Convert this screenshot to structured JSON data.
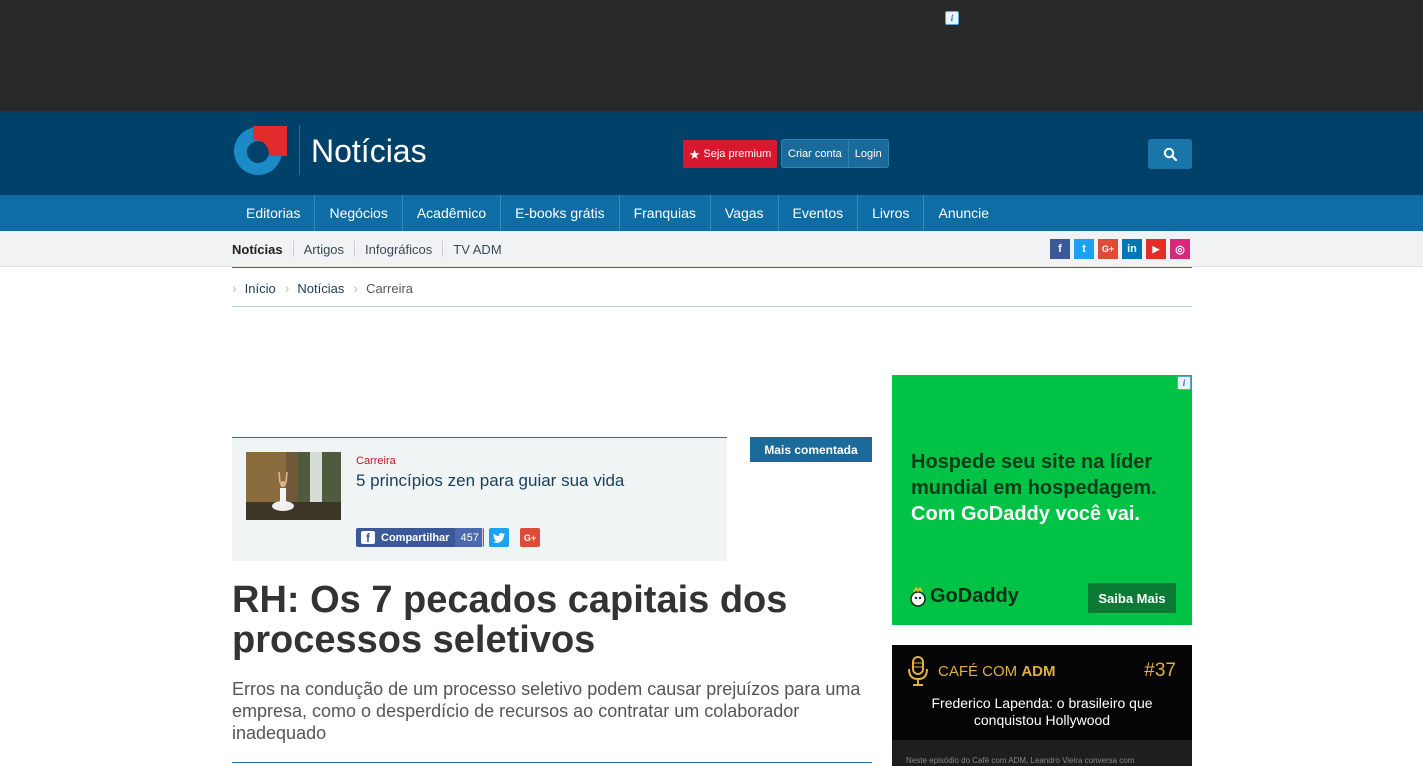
{
  "top_ad": {
    "adchoices_icon": "info-icon"
  },
  "header": {
    "title": "Notícias",
    "premium_label": "Seja premium",
    "create_account_label": "Criar conta",
    "login_label": "Login"
  },
  "main_nav": [
    "Editorias",
    "Negócios",
    "Acadêmico",
    "E-books grátis",
    "Franquias",
    "Vagas",
    "Eventos",
    "Livros",
    "Anuncie"
  ],
  "sub_nav": [
    "Notícias",
    "Artigos",
    "Infográficos",
    "TV ADM"
  ],
  "social": [
    {
      "name": "facebook",
      "glyph": "f",
      "color": "#3b5998"
    },
    {
      "name": "twitter",
      "glyph": "t",
      "color": "#1da1f2"
    },
    {
      "name": "google-plus",
      "glyph": "G+",
      "color": "#dd4b39"
    },
    {
      "name": "linkedin",
      "glyph": "in",
      "color": "#0077b5"
    },
    {
      "name": "youtube",
      "glyph": "▶",
      "color": "#e52d27"
    },
    {
      "name": "instagram",
      "glyph": "◎",
      "color": "#d6297a"
    }
  ],
  "breadcrumb": [
    "Início",
    "Notícias",
    "Carreira"
  ],
  "related": {
    "kicker": "Carreira",
    "title": "5 princípios zen para guiar sua vida",
    "share_label": "Compartilhar",
    "share_count": "457",
    "gplus_label": "G+"
  },
  "badge": "Mais comentada",
  "article": {
    "headline": "RH: Os 7 pecados capitais dos processos seletivos",
    "subhead": "Erros na condução de um processo seletivo podem causar prejuízos para uma empresa, como o desperdício de recursos ao contratar um colaborador inadequado"
  },
  "sidebar_ad": {
    "line1": "Hospede seu site na líder",
    "line2": "mundial em hospedagem.",
    "line3": "Com GoDaddy você vai.",
    "logo": "GoDaddy",
    "button": "Saiba Mais"
  },
  "podcast": {
    "name_prefix": "CAFÉ COM ",
    "name_suffix": "ADM",
    "episode": "#37",
    "title": "Frederico Lapenda: o brasileiro que conquistou Hollywood",
    "description": "Neste episódio do Café com ADM, Leandro Vieira conversa com"
  }
}
